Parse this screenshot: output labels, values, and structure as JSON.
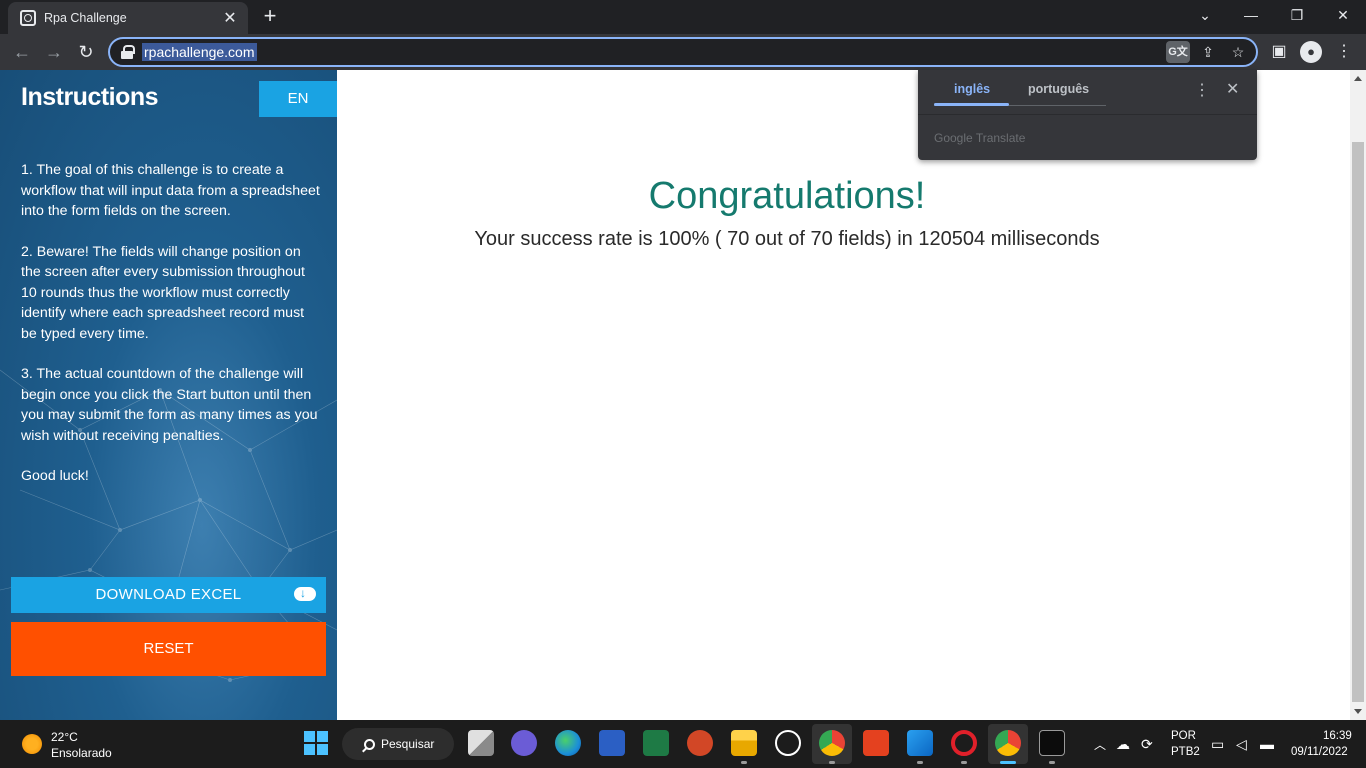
{
  "browser": {
    "tab_title": "Rpa Challenge",
    "tab_close": "✕",
    "new_tab": "+",
    "url": "rpachallenge.com",
    "window_controls": {
      "minimize": "⌄",
      "restore": "—",
      "maximize": "❐",
      "close": "✕"
    }
  },
  "sidebar": {
    "title": "Instructions",
    "language_button": "EN",
    "paragraphs": [
      "1. The goal of this challenge is to create a workflow that will input data from a spreadsheet into the form fields on the screen.",
      "2. Beware! The fields will change position on the screen after every submission throughout 10 rounds thus the workflow must correctly identify where each spreadsheet record must be typed every time.",
      "3. The actual countdown of the challenge will begin once you click the Start button until then you may submit the form as many times as you wish without receiving penalties.",
      "Good luck!"
    ],
    "download_button": "DOWNLOAD EXCEL",
    "reset_button": "RESET"
  },
  "main": {
    "headline": "Congratulations!",
    "result": "Your success rate is 100% ( 70 out of 70 fields) in 120504 milliseconds"
  },
  "translate_popup": {
    "tab_source": "inglês",
    "tab_target": "português",
    "brand": "Google Translate"
  },
  "taskbar": {
    "weather_temp": "22°C",
    "weather_desc": "Ensolarado",
    "search_label": "Pesquisar",
    "lang_code": "POR",
    "keyboard": "PTB2",
    "time": "16:39",
    "date": "09/11/2022"
  },
  "colors": {
    "headline": "#157a6e",
    "download_button": "#1aa3e3",
    "reset_button": "#ff5000",
    "sidebar": "#1f5f8f",
    "omnibox_focus": "#8ab4f8"
  }
}
